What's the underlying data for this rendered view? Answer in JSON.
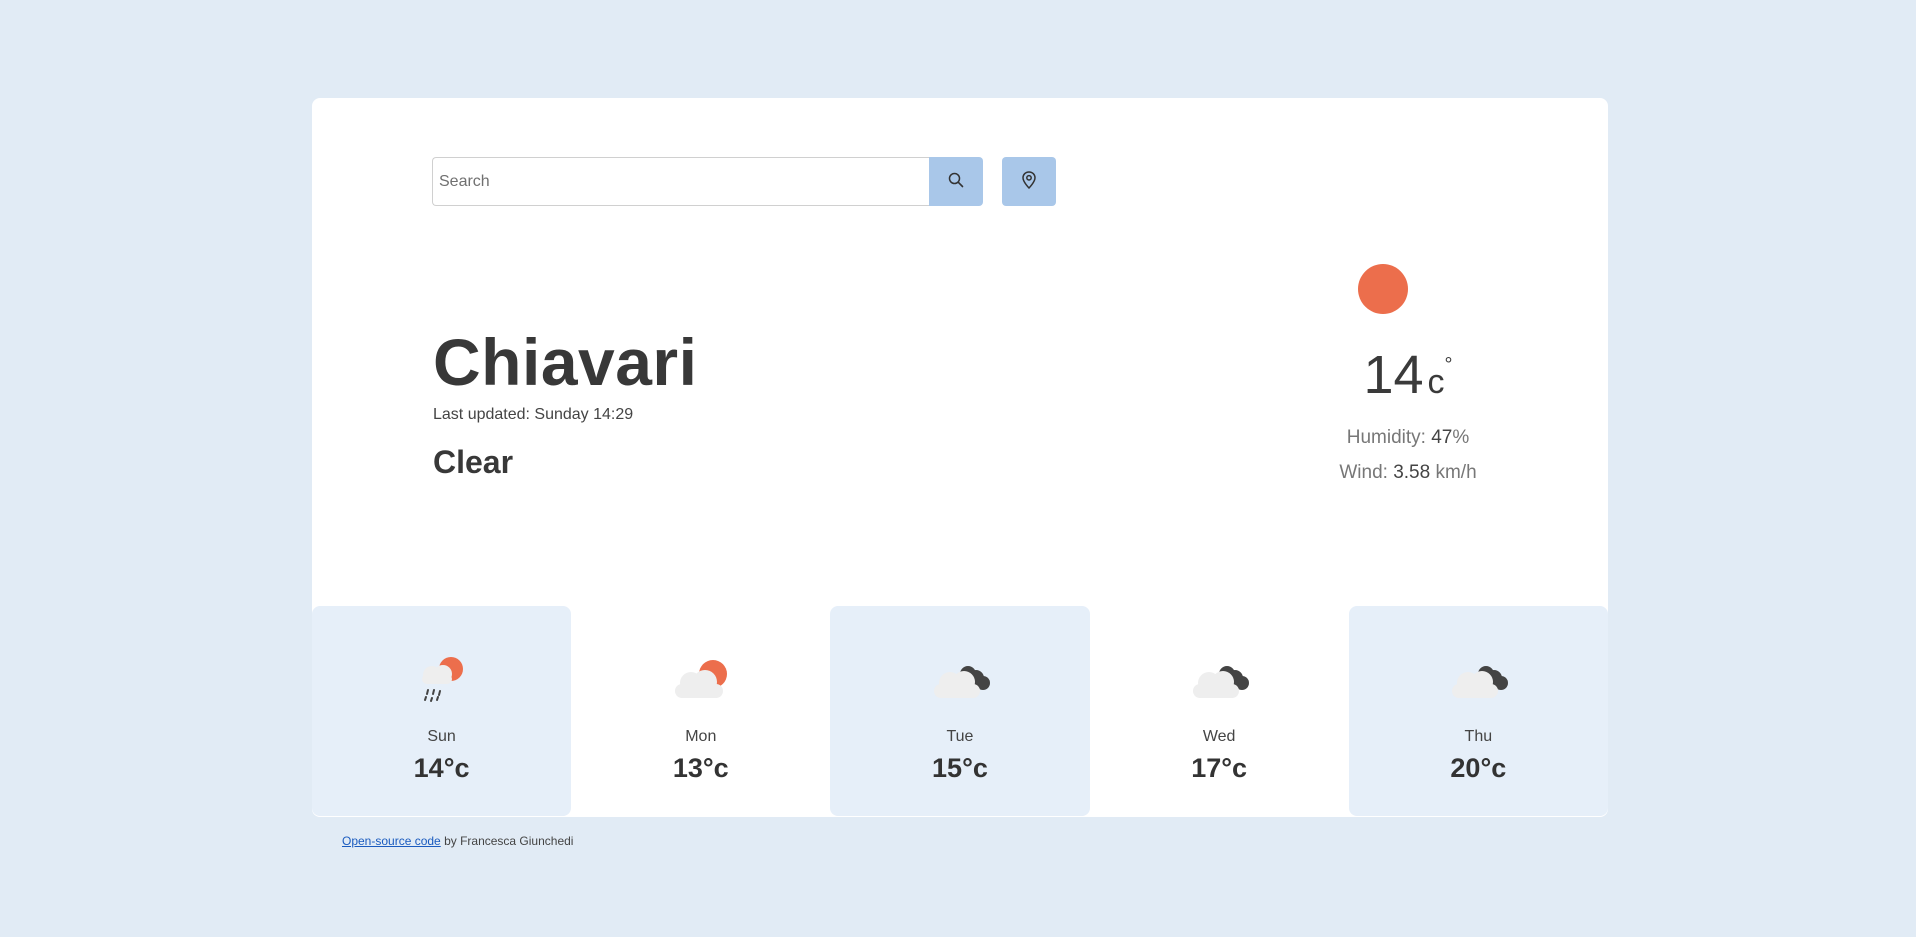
{
  "search": {
    "placeholder": "Search"
  },
  "current": {
    "city": "Chiavari",
    "last_updated": "Last updated: Sunday 14:29",
    "condition": "Clear",
    "temperature": "14",
    "unit": "c",
    "degree": "°",
    "humidity_label": "Humidity:",
    "humidity_value": "47",
    "humidity_unit": "%",
    "wind_label": "Wind:",
    "wind_value": "3.58",
    "wind_unit": "km/h"
  },
  "forecast": [
    {
      "day": "Sun",
      "temp": "14°c",
      "icon": "rain-sun-icon"
    },
    {
      "day": "Mon",
      "temp": "13°c",
      "icon": "cloud-sun-icon"
    },
    {
      "day": "Tue",
      "temp": "15°c",
      "icon": "cloud-dark-icon"
    },
    {
      "day": "Wed",
      "temp": "17°c",
      "icon": "cloud-dark-icon"
    },
    {
      "day": "Thu",
      "temp": "20°c",
      "icon": "cloud-dark-icon"
    }
  ],
  "footer": {
    "link_text": "Open-source code",
    "author_text": " by Francesca Giunchedi"
  },
  "colors": {
    "background": "#e1ebf5",
    "accent_button": "#a9c7e9",
    "sun": "#ec6e4c",
    "card_shade": "#e6eff9"
  }
}
